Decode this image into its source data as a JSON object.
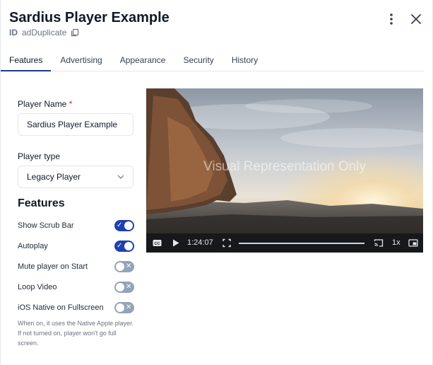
{
  "header": {
    "title": "Sardius Player Example",
    "id_label": "ID",
    "id_value": "adDuplicate"
  },
  "tabs": [
    {
      "label": "Features",
      "active": true
    },
    {
      "label": "Advertising",
      "active": false
    },
    {
      "label": "Appearance",
      "active": false
    },
    {
      "label": "Security",
      "active": false
    },
    {
      "label": "History",
      "active": false
    }
  ],
  "form": {
    "player_name_label": "Player Name",
    "required_mark": "*",
    "player_name_value": "Sardius Player Example",
    "player_type_label": "Player type",
    "player_type_value": "Legacy Player"
  },
  "features": {
    "heading": "Features",
    "items": [
      {
        "label": "Show Scrub Bar",
        "on": true
      },
      {
        "label": "Autoplay",
        "on": true
      },
      {
        "label": "Mute player on Start",
        "on": false
      },
      {
        "label": "Loop Video",
        "on": false
      },
      {
        "label": "iOS Native on Fullscreen",
        "on": false
      }
    ],
    "help_text": "When on, it uses the Native Apple player. If not turned on, player won't go full screen.",
    "on_glyph": "✓",
    "off_glyph": "✕"
  },
  "video": {
    "overlay_text": "Visual Representation Only",
    "time": "1:24:07",
    "speed": "1x"
  },
  "colors": {
    "accent": "#1e40af",
    "toggle_off": "#94a3b8",
    "required": "#dc2626"
  }
}
